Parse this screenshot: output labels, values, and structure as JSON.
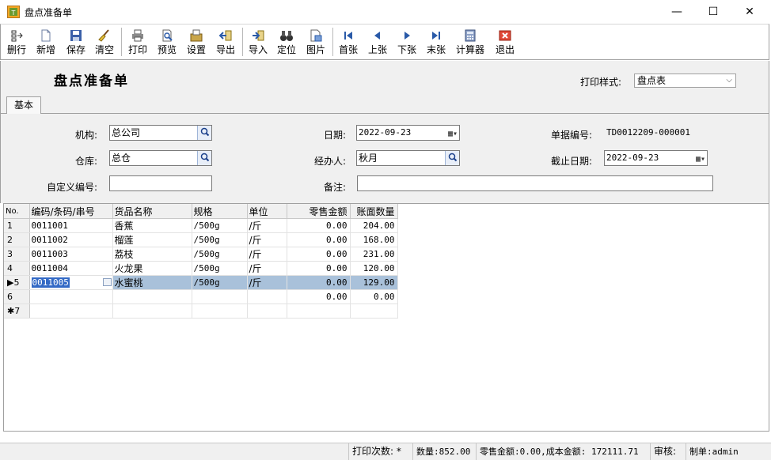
{
  "window": {
    "title": "盘点准备单",
    "minimize": "—",
    "maximize": "☐",
    "close": "✕"
  },
  "toolbar": [
    {
      "id": "delete-row",
      "label": "删行",
      "icon": "delete-row-icon"
    },
    {
      "id": "new",
      "label": "新增",
      "icon": "new-document-icon"
    },
    {
      "id": "save",
      "label": "保存",
      "icon": "save-icon"
    },
    {
      "id": "clear",
      "label": "清空",
      "icon": "broom-icon"
    },
    {
      "id": "print",
      "label": "打印",
      "icon": "printer-icon"
    },
    {
      "id": "preview",
      "label": "预览",
      "icon": "print-preview-icon"
    },
    {
      "id": "settings",
      "label": "设置",
      "icon": "settings-icon"
    },
    {
      "id": "export",
      "label": "导出",
      "icon": "export-icon"
    },
    {
      "id": "import",
      "label": "导入",
      "icon": "import-icon"
    },
    {
      "id": "locate",
      "label": "定位",
      "icon": "binoculars-icon"
    },
    {
      "id": "image",
      "label": "图片",
      "icon": "image-icon"
    },
    {
      "id": "first",
      "label": "首张",
      "icon": "first-record-icon"
    },
    {
      "id": "prev",
      "label": "上张",
      "icon": "previous-record-icon"
    },
    {
      "id": "next",
      "label": "下张",
      "icon": "next-record-icon"
    },
    {
      "id": "last",
      "label": "末张",
      "icon": "last-record-icon"
    },
    {
      "id": "calculator",
      "label": "计算器",
      "icon": "calculator-icon"
    },
    {
      "id": "exit",
      "label": "退出",
      "icon": "exit-icon"
    }
  ],
  "header": {
    "heading": "盘点准备单",
    "print_style_label": "打印样式:",
    "print_style_value": "盘点表"
  },
  "tabs": {
    "basic": "基本"
  },
  "form": {
    "org_label": "机构:",
    "org_value": "总公司",
    "warehouse_label": "仓库:",
    "warehouse_value": "总仓",
    "custom_no_label": "自定义编号:",
    "custom_no_value": "",
    "date_label": "日期:",
    "date_value": "2022-09-23",
    "handler_label": "经办人:",
    "handler_value": "秋月",
    "remark_label": "备注:",
    "remark_value": "",
    "doc_no_label": "单据编号:",
    "doc_no_value": "TD0012209-000001",
    "cutoff_label": "截止日期:",
    "cutoff_value": "2022-09-23"
  },
  "grid": {
    "columns": [
      "No.",
      "编码/条码/串号",
      "货品名称",
      "规格",
      "单位",
      "零售金额",
      "账面数量"
    ],
    "rows": [
      {
        "no": "1",
        "code": "0011001",
        "name": "香蕉",
        "spec": "/500g",
        "unit": "/斤",
        "retail": "0.00",
        "qty": "204.00"
      },
      {
        "no": "2",
        "code": "0011002",
        "name": "榴莲",
        "spec": "/500g",
        "unit": "/斤",
        "retail": "0.00",
        "qty": "168.00"
      },
      {
        "no": "3",
        "code": "0011003",
        "name": "荔枝",
        "spec": "/500g",
        "unit": "/斤",
        "retail": "0.00",
        "qty": "231.00"
      },
      {
        "no": "4",
        "code": "0011004",
        "name": "火龙果",
        "spec": "/500g",
        "unit": "/斤",
        "retail": "0.00",
        "qty": "120.00"
      },
      {
        "no": "▶5",
        "code": "0011005",
        "name": "水蜜桃",
        "spec": "/500g",
        "unit": "/斤",
        "retail": "0.00",
        "qty": "129.00"
      },
      {
        "no": "6",
        "code": "",
        "name": "",
        "spec": "",
        "unit": "",
        "retail": "0.00",
        "qty": "0.00"
      },
      {
        "no": "✱7",
        "code": "",
        "name": "",
        "spec": "",
        "unit": "",
        "retail": "",
        "qty": ""
      }
    ]
  },
  "status": {
    "print_count": "打印次数: *",
    "quantity": "数量:852.00",
    "amounts": "零售金额:0.00,成本金额: 172111.71",
    "audit": "审核:",
    "maker": "制单:admin"
  }
}
